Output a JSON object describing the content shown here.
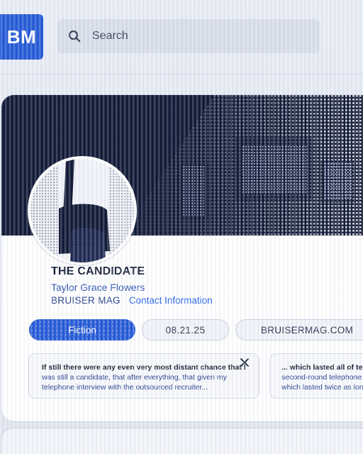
{
  "logo": {
    "text": "BM"
  },
  "search": {
    "placeholder": "Search"
  },
  "profile": {
    "title": "THE CANDIDATE",
    "author": "Taylor Grace Flowers",
    "publication": "BRUISER MAG",
    "contact_label": "Contact Information"
  },
  "tags": [
    {
      "label": "Fiction",
      "active": true
    },
    {
      "label": "08.21.25",
      "active": false
    },
    {
      "label": "BRUISERMAG.COM",
      "active": false
    }
  ],
  "excerpts": [
    {
      "line1": "If still there were any even very most distant chance that I",
      "line2": "was still a candidate, that after everything, that given my",
      "line3": "telephone interview with the outsourced recruiter..."
    },
    {
      "line1": "... which lasted all of ten",
      "line2": "second-round telephone",
      "line3": "which lasted twice as long"
    }
  ],
  "colors": {
    "accent": "#1f56d6",
    "cover": "#0b1431",
    "link": "#2563eb"
  },
  "icons": [
    "search-icon",
    "close-icon"
  ]
}
